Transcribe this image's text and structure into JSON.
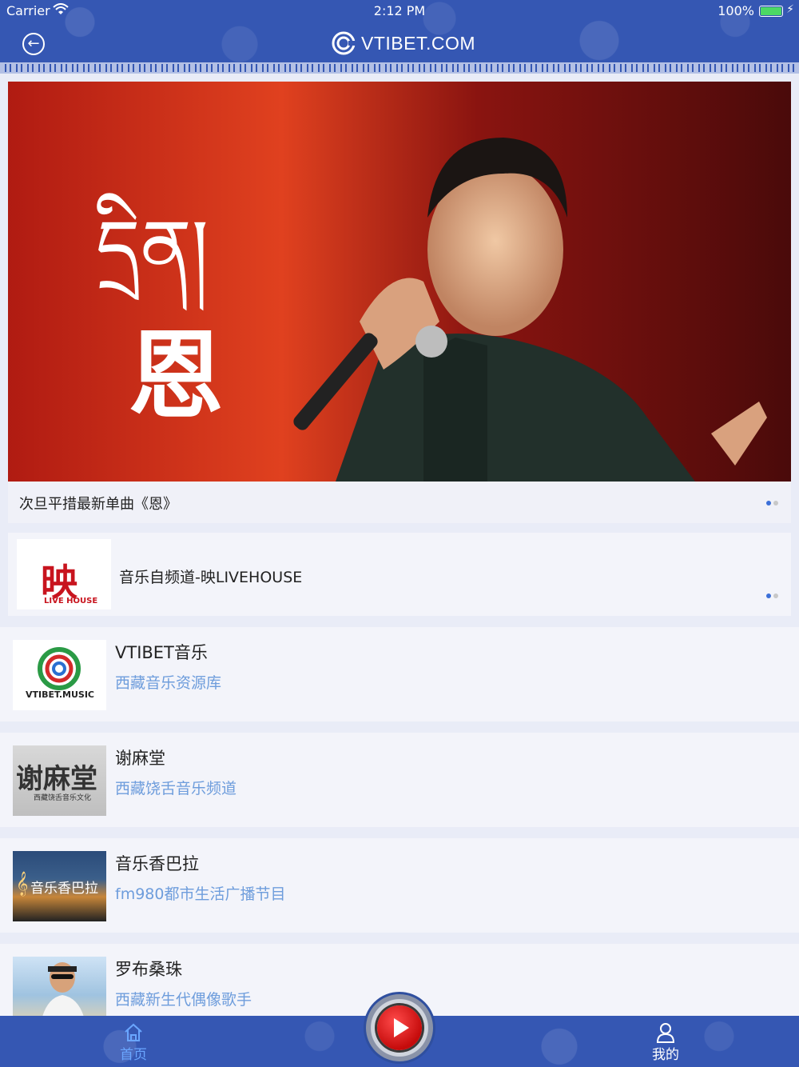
{
  "status": {
    "carrier": "Carrier",
    "time": "2:12 PM",
    "battery": "100%"
  },
  "header": {
    "brand": "VTIBET.COM"
  },
  "banner": {
    "image_title_tibetan": "དྲིན།",
    "image_title_chinese": "恩",
    "caption": "次旦平措最新单曲《恩》"
  },
  "featured": {
    "thumb_text_main": "映",
    "thumb_text_sub": "LIVE HOUSE",
    "title": "音乐自频道-映LIVEHOUSE"
  },
  "list": [
    {
      "title": "VTIBET音乐",
      "subtitle": "西藏音乐资源库",
      "thumb_text": "VTIBET.MUSIC"
    },
    {
      "title": "谢麻堂",
      "subtitle": "西藏饶舌音乐频道",
      "thumb_text": "谢麻堂",
      "thumb_sub": "西藏饶舌音乐文化"
    },
    {
      "title": "音乐香巴拉",
      "subtitle": "fm980都市生活广播节目",
      "thumb_text": "音乐香巴拉"
    },
    {
      "title": "罗布桑珠",
      "subtitle": "西藏新生代偶像歌手"
    }
  ],
  "tabs": {
    "home": "首页",
    "mine": "我的"
  },
  "colors": {
    "header": "#3557b3",
    "accent": "#3b6fd8",
    "subtitle": "#6e9ddc",
    "play": "#d01010"
  }
}
